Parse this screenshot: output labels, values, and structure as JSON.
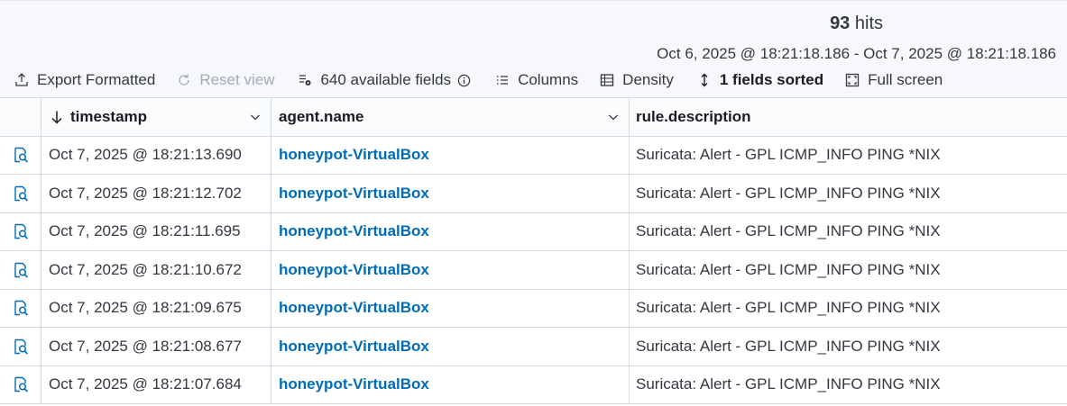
{
  "summary": {
    "hits_count": "93",
    "hits_label": "hits",
    "date_range": "Oct 6, 2025 @ 18:21:18.186 - Oct 7, 2025 @ 18:21:18.186"
  },
  "toolbar": {
    "export_label": "Export Formatted",
    "reset_label": "Reset view",
    "fields_label": "640 available fields",
    "columns_label": "Columns",
    "density_label": "Density",
    "sorted_label": "1 fields sorted",
    "fullscreen_label": "Full screen"
  },
  "columns": [
    "timestamp",
    "agent.name",
    "rule.description"
  ],
  "rows": [
    {
      "timestamp": "Oct 7, 2025 @ 18:21:13.690",
      "agent": "honeypot-VirtualBox",
      "rule": "Suricata: Alert - GPL ICMP_INFO PING *NIX"
    },
    {
      "timestamp": "Oct 7, 2025 @ 18:21:12.702",
      "agent": "honeypot-VirtualBox",
      "rule": "Suricata: Alert - GPL ICMP_INFO PING *NIX"
    },
    {
      "timestamp": "Oct 7, 2025 @ 18:21:11.695",
      "agent": "honeypot-VirtualBox",
      "rule": "Suricata: Alert - GPL ICMP_INFO PING *NIX"
    },
    {
      "timestamp": "Oct 7, 2025 @ 18:21:10.672",
      "agent": "honeypot-VirtualBox",
      "rule": "Suricata: Alert - GPL ICMP_INFO PING *NIX"
    },
    {
      "timestamp": "Oct 7, 2025 @ 18:21:09.675",
      "agent": "honeypot-VirtualBox",
      "rule": "Suricata: Alert - GPL ICMP_INFO PING *NIX"
    },
    {
      "timestamp": "Oct 7, 2025 @ 18:21:08.677",
      "agent": "honeypot-VirtualBox",
      "rule": "Suricata: Alert - GPL ICMP_INFO PING *NIX"
    },
    {
      "timestamp": "Oct 7, 2025 @ 18:21:07.684",
      "agent": "honeypot-VirtualBox",
      "rule": "Suricata: Alert - GPL ICMP_INFO PING *NIX"
    }
  ],
  "icons": {
    "export": "export-icon",
    "reset": "refresh-icon",
    "fields": "fields-icon",
    "info": "info-icon",
    "columns": "list-icon",
    "density": "table-density-icon",
    "sort": "sort-icon",
    "fullscreen": "fullscreen-icon",
    "inspect": "inspect-document-icon"
  },
  "colors": {
    "link": "#006bb8",
    "border": "#d3dae6",
    "disabled": "#a2abba"
  }
}
